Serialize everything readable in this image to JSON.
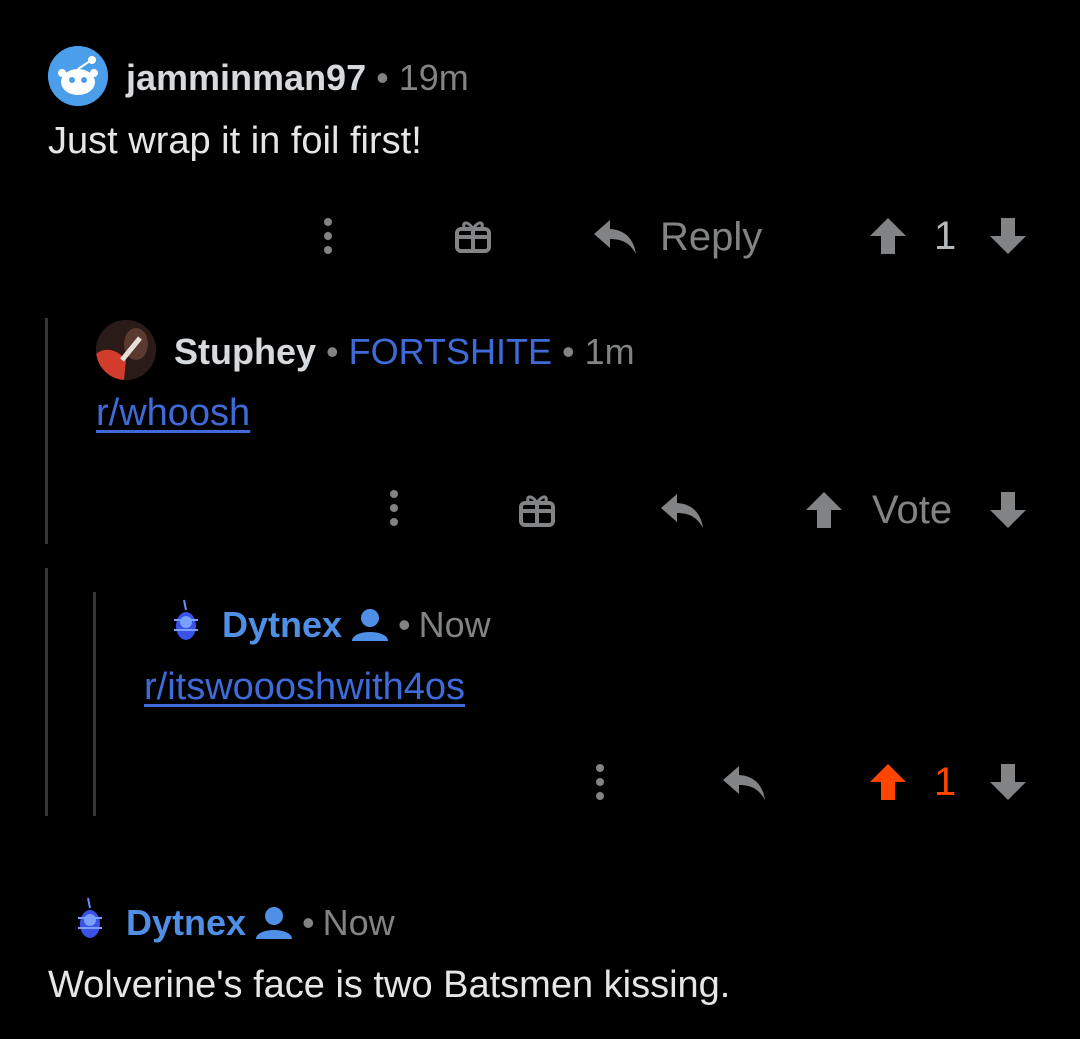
{
  "comments": [
    {
      "author": "jamminman97",
      "time": "19m",
      "body": "Just wrap it in foil first!",
      "reply_label": "Reply",
      "score": "1"
    },
    {
      "author": "Stuphey",
      "flair": "FORTSHITE",
      "time": "1m",
      "body": "r/whoosh",
      "vote_label": "Vote"
    },
    {
      "author": "Dytnex",
      "time": "Now",
      "body": "r/itswoooshwith4os",
      "score": "1",
      "upvoted": true
    },
    {
      "author": "Dytnex",
      "time": "Now",
      "body": "Wolverine's face is two Batsmen kissing."
    }
  ],
  "separator": "•",
  "colors": {
    "background": "#000000",
    "link": "#3f6bd8",
    "op_name": "#4f8fe6",
    "upvote_active": "#ff4500",
    "muted": "#818384"
  }
}
